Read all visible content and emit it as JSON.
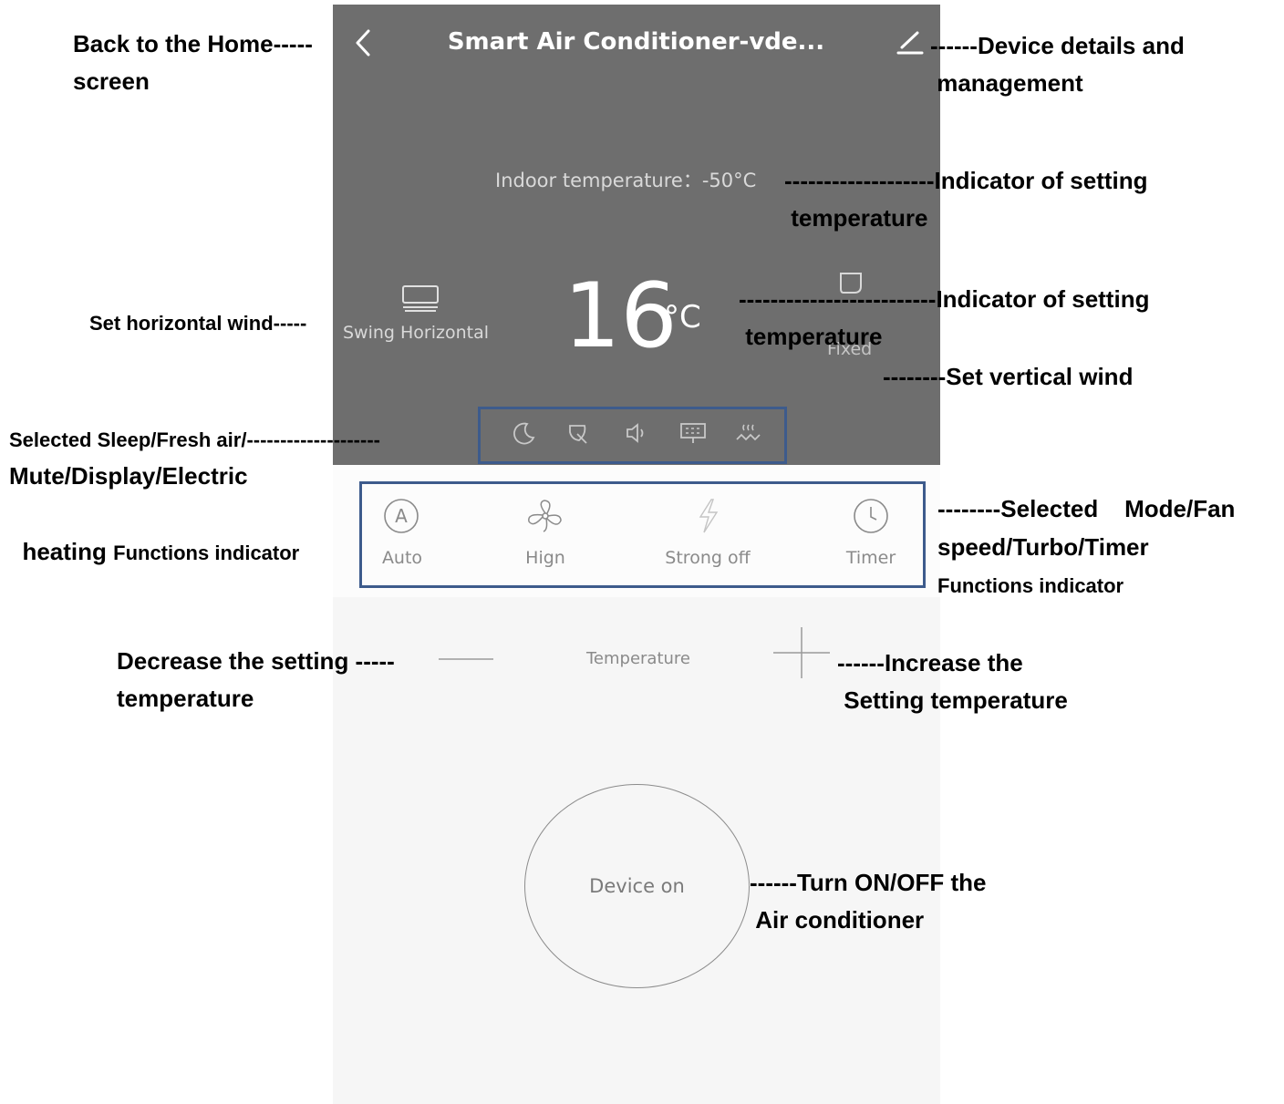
{
  "app": {
    "title": "Smart Air Conditioner-vde...",
    "indoor_temperature": "Indoor temperature：-50°C",
    "set_temperature": "16",
    "temperature_unit": "°C",
    "swing_label": "Swing Horizontal",
    "fixed_label": "Fixed",
    "function_icons": [
      "sleep-moon-icon",
      "fresh-air-leaf-icon",
      "mute-speaker-icon",
      "display-icon",
      "electric-heating-icon"
    ],
    "modes": [
      {
        "label": "Auto",
        "icon": "auto-mode-icon"
      },
      {
        "label": "Hign",
        "icon": "fan-icon"
      },
      {
        "label": "Strong off",
        "icon": "turbo-lightning-icon"
      },
      {
        "label": "Timer",
        "icon": "clock-icon"
      }
    ],
    "temperature_label": "Temperature",
    "power_button": "Device on",
    "colors": {
      "panel": "#6e6e6e",
      "box": "#3d5b8c",
      "light": "#f6f6f6"
    }
  },
  "annotations": {
    "back": "Back to the Home-----\nscreen",
    "device_details": "------Device details and\n management",
    "indoor_indicator": "-------------------Indicator of setting\n temperature",
    "setting_indicator": "-------------------------Indicator of setting\n temperature",
    "vertical_wind": "--------Set vertical wind",
    "horizontal_wind": "Set horizontal wind-----",
    "functions_line1": "Selected Sleep/Fresh air/--------------------",
    "functions_line2": "Mute/Display/Electric",
    "functions_line3_big": "heating ",
    "functions_line3_small": "Functions indicator",
    "mode_line1": "--------Selected    Mode/Fan",
    "mode_line2": "speed/Turbo/Timer",
    "mode_line3": "Functions indicator",
    "decrease": "Decrease the setting -----\ntemperature",
    "increase": "------Increase the\n Setting temperature",
    "power": "------Turn ON/OFF the\n Air conditioner"
  }
}
